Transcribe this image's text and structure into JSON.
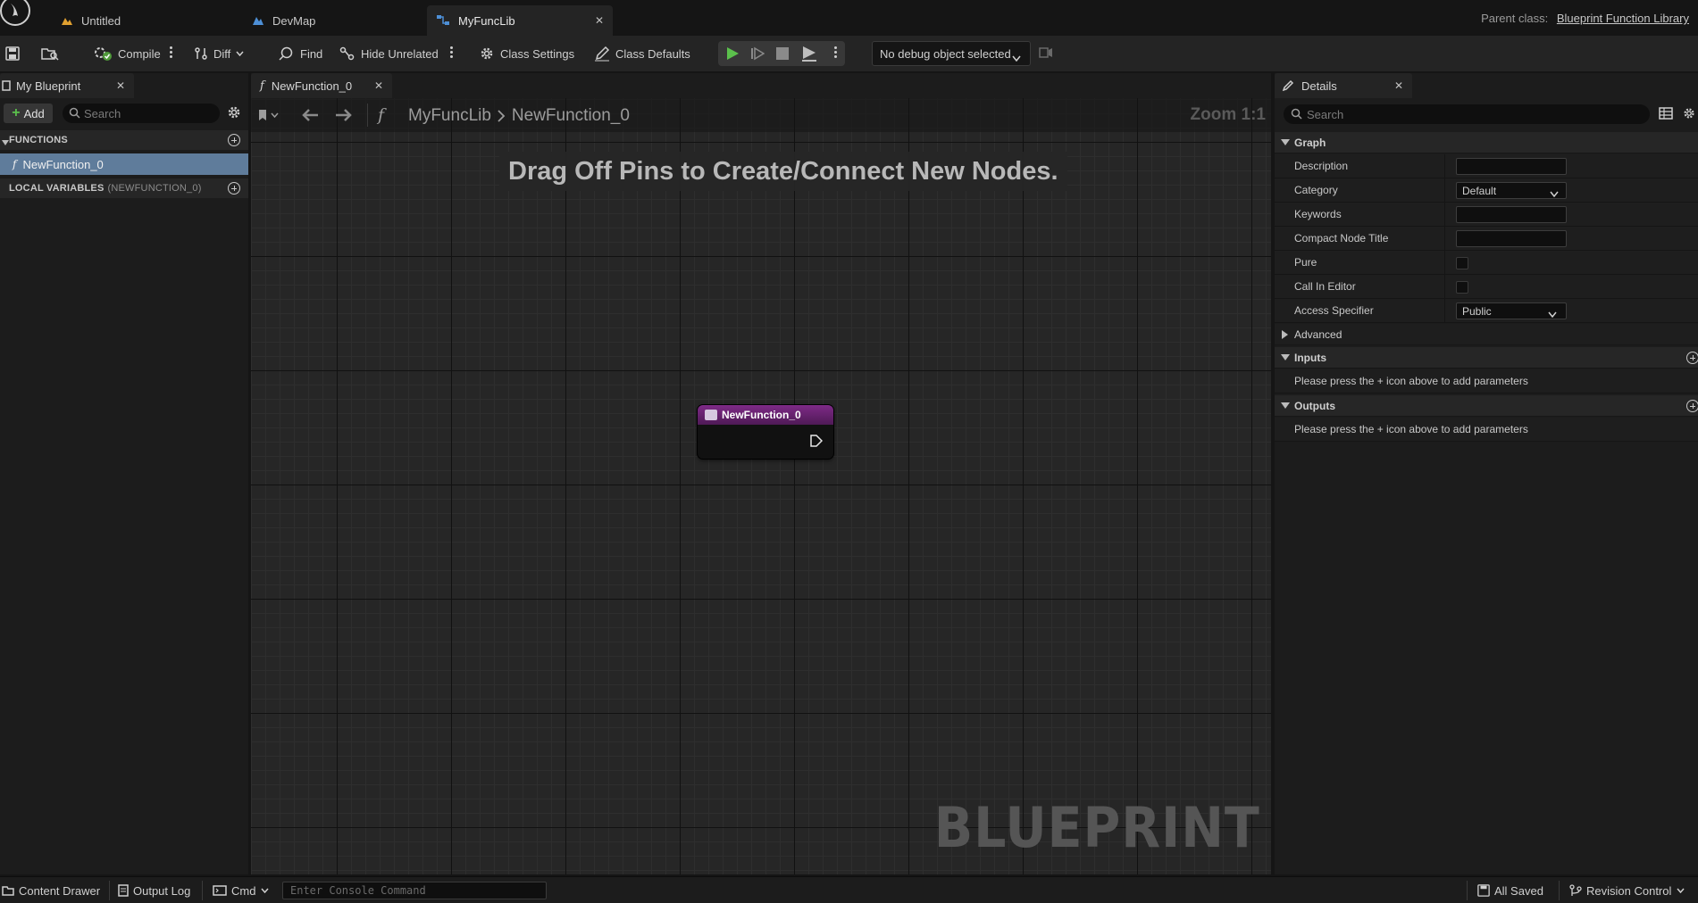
{
  "title_bar": {
    "tabs": [
      {
        "label": "Untitled",
        "icon": "level-icon"
      },
      {
        "label": "DevMap",
        "icon": "map-icon"
      },
      {
        "label": "MyFuncLib",
        "icon": "blueprint-icon",
        "active": true
      }
    ],
    "parent_class_label": "Parent class:",
    "parent_class_value": "Blueprint Function Library"
  },
  "toolbar": {
    "compile": "Compile",
    "diff": "Diff",
    "find": "Find",
    "hide_unrelated": "Hide Unrelated",
    "class_settings": "Class Settings",
    "class_defaults": "Class Defaults",
    "debug_object": "No debug object selected"
  },
  "my_blueprint": {
    "tab_label": "My Blueprint",
    "add_label": "Add",
    "search_placeholder": "Search",
    "functions_header": "FUNCTIONS",
    "function_items": [
      "NewFunction_0"
    ],
    "local_vars_header": "LOCAL VARIABLES",
    "local_vars_scope": "(NEWFUNCTION_0)"
  },
  "graph": {
    "tab_label": "NewFunction_0",
    "breadcrumb": [
      "MyFuncLib",
      "NewFunction_0"
    ],
    "zoom": "Zoom 1:1",
    "hint": "Drag Off Pins to Create/Connect New Nodes.",
    "watermark": "BLUEPRINT",
    "node_title": "NewFunction_0"
  },
  "details": {
    "tab_label": "Details",
    "search_placeholder": "Search",
    "graph_header": "Graph",
    "rows": {
      "description": "Description",
      "category": "Category",
      "category_value": "Default",
      "keywords": "Keywords",
      "compact_node_title": "Compact Node Title",
      "pure": "Pure",
      "call_in_editor": "Call In Editor",
      "access_specifier": "Access Specifier",
      "access_value": "Public"
    },
    "advanced_header": "Advanced",
    "inputs_header": "Inputs",
    "inputs_info": "Please press the + icon above to add parameters",
    "outputs_header": "Outputs",
    "outputs_info": "Please press the + icon above to add parameters"
  },
  "status_bar": {
    "content_drawer": "Content Drawer",
    "output_log": "Output Log",
    "cmd": "Cmd",
    "console_placeholder": "Enter Console Command",
    "all_saved": "All Saved",
    "revision_control": "Revision Control"
  },
  "colors": {
    "accent_selection": "#5f7c9b",
    "node_header": "#7e2a87",
    "play_green": "#5bc04c"
  }
}
